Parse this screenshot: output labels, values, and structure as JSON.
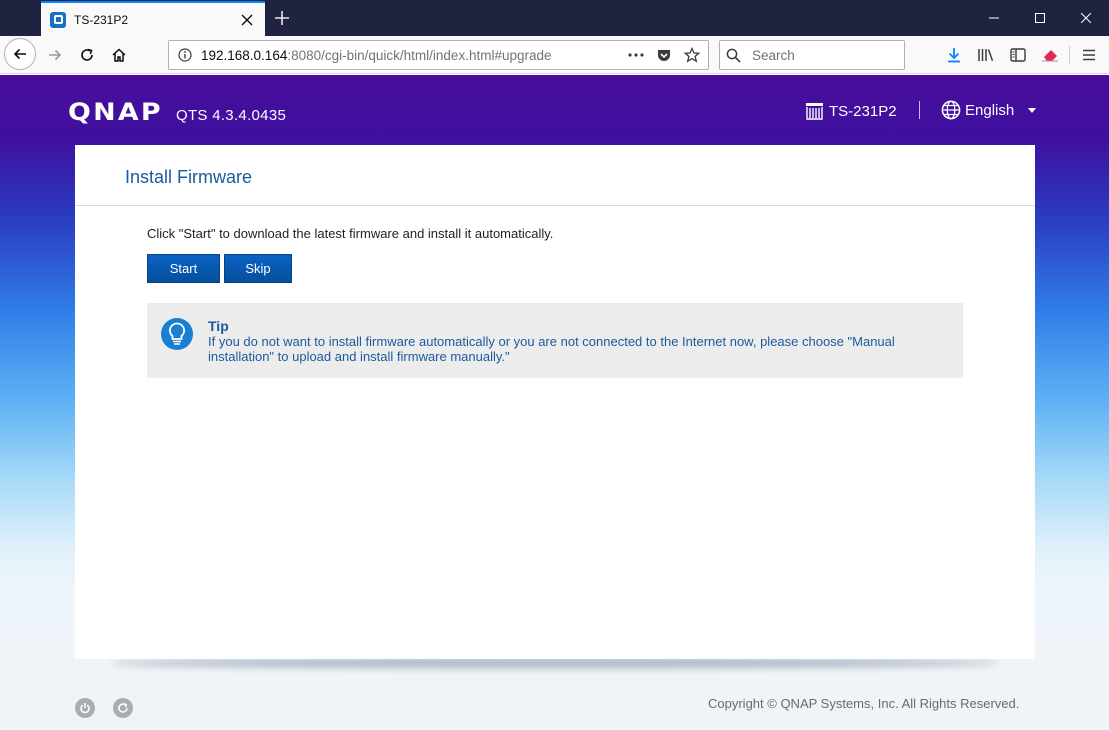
{
  "browser": {
    "tab_title": "TS-231P2",
    "url_host": "192.168.0.164",
    "url_rest": ":8080/cgi-bin/quick/html/index.html#upgrade",
    "search_placeholder": "Search"
  },
  "header": {
    "logo": "QNAP",
    "version": "QTS 4.3.4.0435",
    "device_name": "TS-231P2",
    "language": "English"
  },
  "card": {
    "title": "Install Firmware",
    "instruction": "Click \"Start\" to download the latest firmware and install it automatically.",
    "start_label": "Start",
    "skip_label": "Skip",
    "tip_title": "Tip",
    "tip_text": "If you do not want to install firmware automatically or you are not connected to the Internet now, please choose \"Manual installation\" to upload and install firmware manually.\""
  },
  "footer": {
    "copyright": "Copyright © QNAP Systems, Inc. All Rights Reserved."
  },
  "colors": {
    "accent_blue": "#1c5a9e",
    "button_blue": "#0a63c4",
    "header_purple": "#4a0d9a",
    "firefox_tabstrip": "#202340"
  }
}
